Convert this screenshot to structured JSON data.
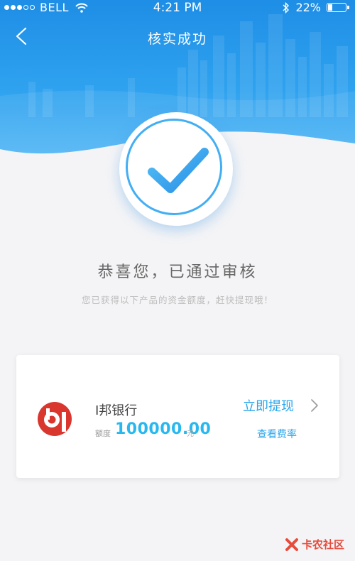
{
  "status_bar": {
    "carrier": "BELL",
    "time": "4:21 PM",
    "battery": "22%",
    "battery_level": 0.22,
    "signal_dots_filled": 3,
    "signal_dots_total": 5
  },
  "nav": {
    "title": "核实成功",
    "back_icon": "chevron-left-icon"
  },
  "result": {
    "icon": "checkmark-icon",
    "heading": "恭喜您，已通过审核",
    "subtext": "您已获得以下产品的资金额度，赶快提现哦！"
  },
  "loan_card": {
    "bank_name": "I邦银行",
    "limit_label": "额度",
    "limit_value": "100000.00",
    "limit_unit": "元",
    "withdraw_label": "立即提现",
    "rates_label": "查看费率",
    "logo_icon": "bank-logo-icon"
  },
  "watermark": {
    "text": "卡农社区"
  },
  "colors": {
    "header_blue": "#1e8ee6",
    "accent_blue": "#2ba6ec",
    "limit_cyan": "#28b8ef",
    "logo_red": "#d9362e",
    "watermark_red": "#e64b3c"
  }
}
